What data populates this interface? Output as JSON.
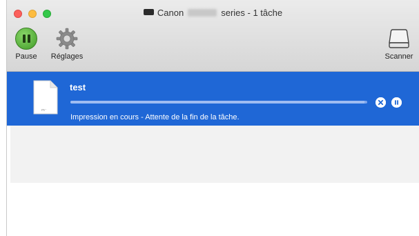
{
  "window": {
    "title_prefix": "Canon",
    "title_suffix": "series - 1 tâche"
  },
  "toolbar": {
    "pause_label": "Pause",
    "settings_label": "Réglages",
    "scanner_label": "Scanner"
  },
  "job": {
    "name": "test",
    "doc_icon_text": "m⁻",
    "status": "Impression en cours - Attente de la fin de la tâche.",
    "progress": 0.99
  },
  "colors": {
    "selection": "#1f67d6",
    "pause_green": "#3f9a26"
  },
  "icons": {
    "pause": "pause-icon",
    "settings": "gear-icon",
    "scanner": "scanner-icon",
    "cancel": "cancel-icon",
    "hold": "hold-icon"
  }
}
